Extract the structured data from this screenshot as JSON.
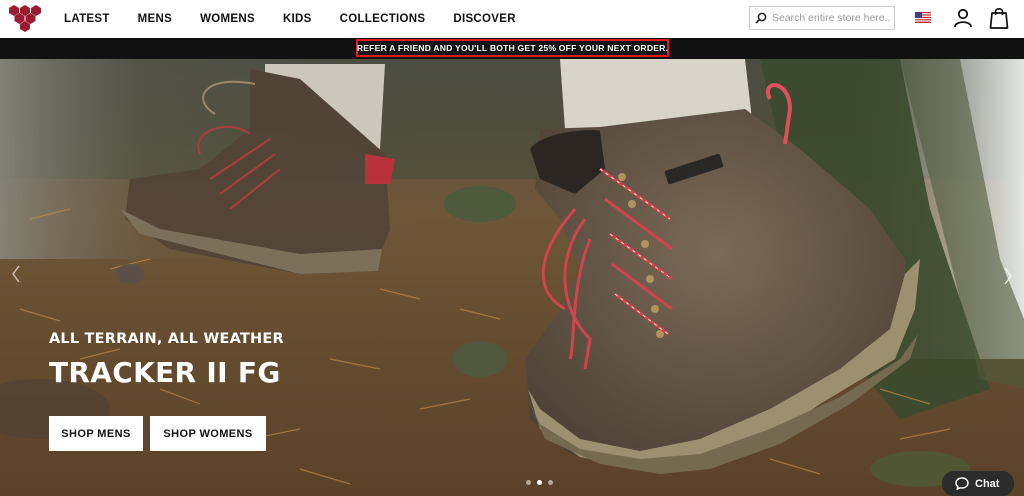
{
  "header": {
    "logo": "vivobarefoot-logo-icon",
    "nav": [
      "LATEST",
      "MENS",
      "WOMENS",
      "KIDS",
      "COLLECTIONS",
      "DISCOVER"
    ],
    "search_placeholder": "Search entire store here...",
    "icons": [
      "search-icon",
      "us-flag-icon",
      "user-icon",
      "shopping-bag-icon"
    ]
  },
  "promo": {
    "text": "REFER A FRIEND AND YOU'LL BOTH GET 25% OFF YOUR NEXT ORDER.",
    "highlight_color": "#e0191e"
  },
  "hero": {
    "subtitle": "ALL TERRAIN, ALL WEATHER",
    "title": "TRACKER II FG",
    "buttons": {
      "mens": "SHOP MENS",
      "womens": "SHOP WOMENS"
    },
    "slide_count": 3,
    "active_slide": 2
  },
  "chat": {
    "label": "Chat",
    "icon": "chat-bubble-icon"
  },
  "colors": {
    "brand": "#9b1b30",
    "promo_bg": "#111111",
    "chat_bg": "#2b2b2b"
  }
}
